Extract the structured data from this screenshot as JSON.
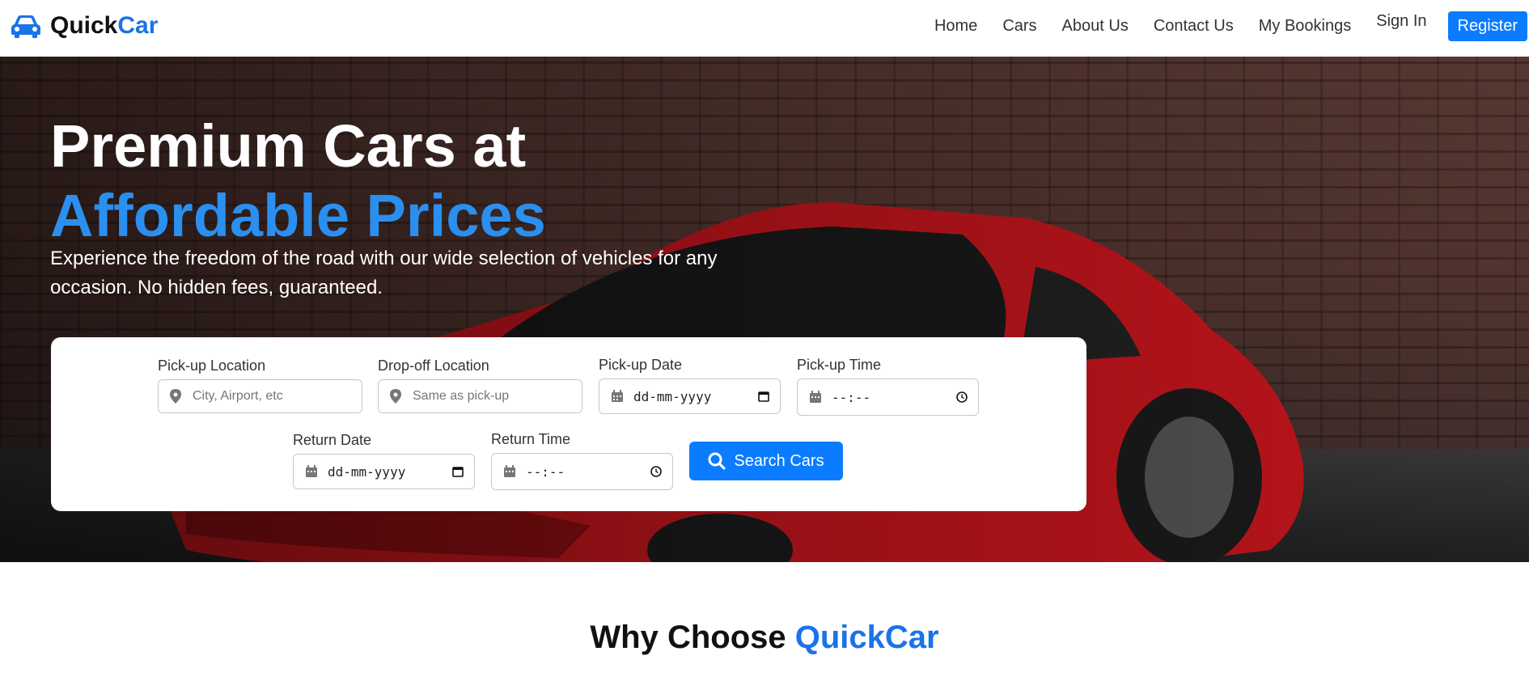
{
  "brand": {
    "part1": "Quick",
    "part2": "Car",
    "accent": "#1a73e8",
    "icon": "car-icon"
  },
  "nav": {
    "items": [
      "Home",
      "Cars",
      "About Us",
      "Contact Us",
      "My Bookings"
    ],
    "sign_in": "Sign In",
    "register": "Register",
    "register_color": "#0b7cff"
  },
  "hero": {
    "title_line1": "Premium Cars at",
    "title_line2": "Affordable Prices",
    "title_accent": "#2a8fef",
    "subtitle": "Experience the freedom of the road with our wide selection of vehicles for any occasion. No hidden fees, guaranteed."
  },
  "search": {
    "pickup_location": {
      "label": "Pick-up Location",
      "placeholder": "City, Airport, etc",
      "icon": "map-pin-icon"
    },
    "dropoff_location": {
      "label": "Drop-off Location",
      "placeholder": "Same as pick-up",
      "icon": "map-pin-icon"
    },
    "pickup_date": {
      "label": "Pick-up Date",
      "value": "dd-mm-yyyy",
      "icon": "calendar-icon"
    },
    "pickup_time": {
      "label": "Pick-up Time",
      "value": "--:--",
      "icon": "calendar-icon"
    },
    "return_date": {
      "label": "Return Date",
      "value": "dd-mm-yyyy",
      "icon": "calendar-icon"
    },
    "return_time": {
      "label": "Return Time",
      "value": "--:--",
      "icon": "calendar-icon"
    },
    "button": "Search Cars"
  },
  "why": {
    "part1": "Why Choose ",
    "part2": "QuickCar"
  }
}
